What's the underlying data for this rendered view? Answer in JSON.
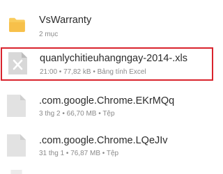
{
  "files": [
    {
      "icon": "folder-icon",
      "title": "VsWarranty",
      "meta": "2 mục"
    },
    {
      "icon": "excel-file-icon",
      "title": "quanlychitieuhangngay-2014-.xls",
      "meta": "21:00 • 77,82 kB • Bảng tính Excel",
      "highlighted": true
    },
    {
      "icon": "file-icon",
      "title": ".com.google.Chrome.EKrMQq",
      "meta": "3 thg 2 • 66,70 MB • Tệp"
    },
    {
      "icon": "file-icon",
      "title": ".com.google.Chrome.LQeJIv",
      "meta": "31 thg 1 • 76,87 MB • Tệp"
    }
  ],
  "colors": {
    "folder": "#f9cc5c",
    "excel_icon": "#d8d8d8",
    "file_icon": "#e2e2e2",
    "highlight_border": "#d9232d"
  }
}
